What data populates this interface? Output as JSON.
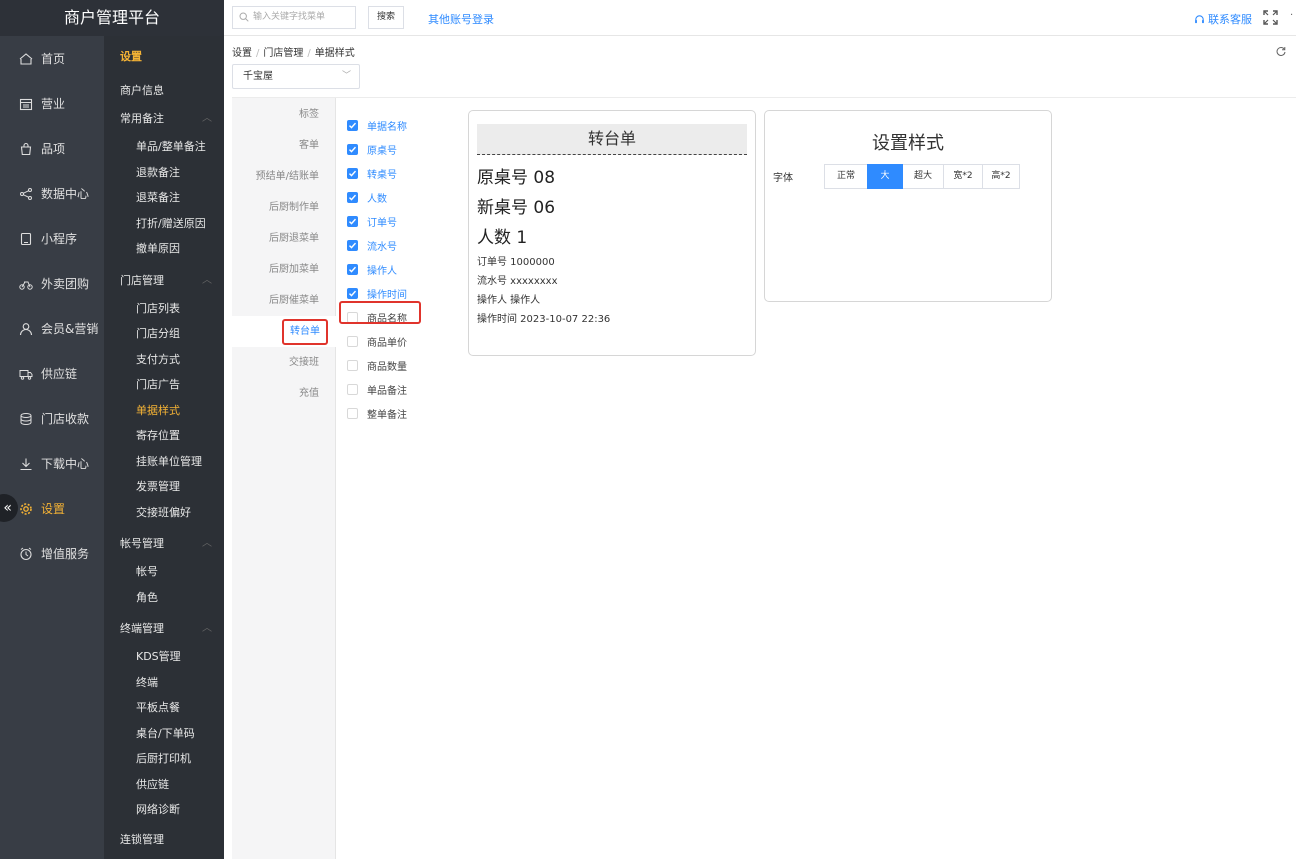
{
  "app": {
    "title": "商户管理平台"
  },
  "mainnav": [
    {
      "label": "首页",
      "icon": "home-icon"
    },
    {
      "label": "营业",
      "icon": "calendar-icon"
    },
    {
      "label": "品项",
      "icon": "bag-icon"
    },
    {
      "label": "数据中心",
      "icon": "share-icon"
    },
    {
      "label": "小程序",
      "icon": "phone-icon"
    },
    {
      "label": "外卖团购",
      "icon": "bike-icon"
    },
    {
      "label": "会员&营销",
      "icon": "user-icon"
    },
    {
      "label": "供应链",
      "icon": "truck-icon"
    },
    {
      "label": "门店收款",
      "icon": "database-icon"
    },
    {
      "label": "下载中心",
      "icon": "download-icon"
    },
    {
      "label": "设置",
      "icon": "gear-icon",
      "active": true
    },
    {
      "label": "增值服务",
      "icon": "clock-icon"
    }
  ],
  "subnav": {
    "header": "设置",
    "top_items": [
      "商户信息"
    ],
    "groups": [
      {
        "title": "常用备注",
        "items": [
          "单品/整单备注",
          "退款备注",
          "退菜备注",
          "打折/赠送原因",
          "撤单原因"
        ]
      },
      {
        "title": "门店管理",
        "items": [
          "门店列表",
          "门店分组",
          "支付方式",
          "门店广告",
          "单据样式",
          "寄存位置",
          "挂账单位管理",
          "发票管理",
          "交接班偏好"
        ]
      },
      {
        "title": "帐号管理",
        "items": [
          "帐号",
          "角色"
        ]
      },
      {
        "title": "终端管理",
        "items": [
          "KDS管理",
          "终端",
          "平板点餐",
          "桌台/下单码",
          "后厨打印机",
          "供应链",
          "网络诊断"
        ]
      }
    ],
    "bottom": "连锁管理"
  },
  "topbar": {
    "search_placeholder": "输入关键字找菜单",
    "search_button": "搜索",
    "other_login": "其他账号登录",
    "contact": "联系客服"
  },
  "breadcrumb": [
    "设置",
    "门店管理",
    "单据样式"
  ],
  "store": "千宝屋",
  "doc_types": [
    "标签",
    "客单",
    "预结单/结账单",
    "后厨制作单",
    "后厨退菜单",
    "后厨加菜单",
    "后厨催菜单",
    "转台单",
    "交接班",
    "充值"
  ],
  "fields": [
    {
      "label": "单据名称",
      "checked": true
    },
    {
      "label": "原桌号",
      "checked": true
    },
    {
      "label": "转桌号",
      "checked": true
    },
    {
      "label": "人数",
      "checked": true
    },
    {
      "label": "订单号",
      "checked": true
    },
    {
      "label": "流水号",
      "checked": true
    },
    {
      "label": "操作人",
      "checked": true
    },
    {
      "label": "操作时间",
      "checked": true
    },
    {
      "label": "商品名称",
      "checked": false
    },
    {
      "label": "商品单价",
      "checked": false
    },
    {
      "label": "商品数量",
      "checked": false
    },
    {
      "label": "单品备注",
      "checked": false
    },
    {
      "label": "整单备注",
      "checked": false
    }
  ],
  "preview": {
    "title": "转台单",
    "big_lines": [
      "原桌号 08",
      "新桌号 06",
      "人数 1"
    ],
    "small_lines": [
      "订单号 1000000",
      "流水号 xxxxxxxx",
      "操作人 操作人",
      "操作时间 2023-10-07 22:36"
    ]
  },
  "style": {
    "title": "设置样式",
    "font_label": "字体",
    "options": [
      "正常",
      "大",
      "超大",
      "宽*2",
      "高*2"
    ],
    "selected": "大"
  },
  "colors": {
    "accent": "#2f8bff",
    "highlight": "#e0342c",
    "nav_active": "#f5b335"
  }
}
